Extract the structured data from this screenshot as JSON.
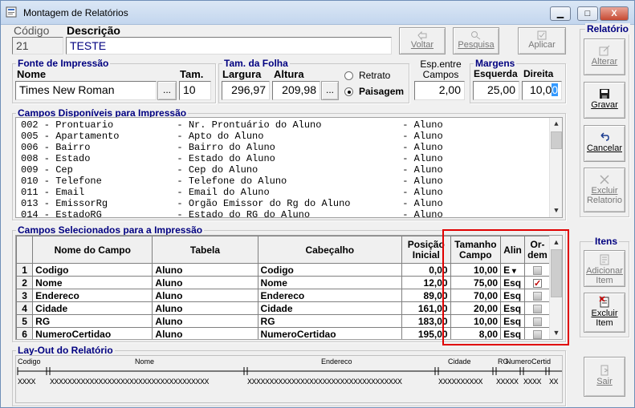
{
  "window": {
    "title": "Montagem de Relatórios",
    "controls": {
      "minimize": "▁",
      "maximize": "□",
      "close": "X"
    }
  },
  "header": {
    "codigo_label": "Código",
    "codigo_value": "21",
    "descricao_label": "Descrição",
    "descricao_value": "TESTE"
  },
  "toolbar": {
    "voltar": "Voltar",
    "pesquisa": "Pesquisa",
    "aplicar": "Aplicar"
  },
  "fonte": {
    "legend": "Fonte de Impressão",
    "nome_label": "Nome",
    "nome_value": "Times New Roman",
    "browse": "...",
    "tam_label": "Tam.",
    "tam_value": "10"
  },
  "folha": {
    "legend": "Tam. da Folha",
    "largura_label": "Largura",
    "largura_value": "296,97",
    "altura_label": "Altura",
    "altura_value": "209,98",
    "browse": "...",
    "retrato": "Retrato",
    "paisagem": "Paisagem",
    "selected": "paisagem"
  },
  "espacamento": {
    "label_line1": "Esp.entre",
    "label_line2": "Campos",
    "value": "2,00"
  },
  "margens": {
    "legend": "Margens",
    "esquerda_label": "Esquerda",
    "esquerda_value": "25,00",
    "direita_label": "Direita",
    "direita_value_main": "10,0",
    "direita_value_sel": "0"
  },
  "relatorio": {
    "legend": "Relatório",
    "alterar": "Alterar",
    "gravar": "Gravar",
    "cancelar": "Cancelar",
    "excluir_line1": "Excluir",
    "excluir_line2": "Relatorio"
  },
  "disponiveis": {
    "legend": "Campos Disponíveis para Impressão",
    "rows": [
      "002 - Prontuario           - Nr. Prontuário do Aluno              - Aluno",
      "005 - Apartamento          - Apto do Aluno                        - Aluno",
      "006 - Bairro               - Bairro do Aluno                      - Aluno",
      "008 - Estado               - Estado do Aluno                      - Aluno",
      "009 - Cep                  - Cep do Aluno                         - Aluno",
      "010 - Telefone             - Telefone do Aluno                    - Aluno",
      "011 - Email                - Email do Aluno                       - Aluno",
      "013 - EmissorRg            - Orgão Emissor do Rg do Aluno         - Aluno",
      "014 - EstadoRG             - Estado do RG do Aluno                - Aluno"
    ]
  },
  "selecionados": {
    "legend": "Campos Selecionados para a Impressão",
    "columns": [
      "Nome do Campo",
      "Tabela",
      "Cabeçalho",
      "Posição Inicial",
      "Tamanho Campo",
      "Alin",
      "Or- dem"
    ],
    "col_posicao": [
      "Posição",
      "Inicial"
    ],
    "col_tamanho": [
      "Tamanho",
      "Campo"
    ],
    "col_ordem": [
      "Or-",
      "dem"
    ],
    "rows": [
      {
        "n": "1",
        "campo": "Codigo",
        "tabela": "Aluno",
        "cabecalho": "Codigo",
        "posicao": "0,00",
        "tamanho": "10,00",
        "alin": "E",
        "ordem": false
      },
      {
        "n": "2",
        "campo": "Nome",
        "tabela": "Aluno",
        "cabecalho": "Nome",
        "posicao": "12,00",
        "tamanho": "75,00",
        "alin": "Esq",
        "ordem": true
      },
      {
        "n": "3",
        "campo": "Endereco",
        "tabela": "Aluno",
        "cabecalho": "Endereco",
        "posicao": "89,00",
        "tamanho": "70,00",
        "alin": "Esq",
        "ordem": false
      },
      {
        "n": "4",
        "campo": "Cidade",
        "tabela": "Aluno",
        "cabecalho": "Cidade",
        "posicao": "161,00",
        "tamanho": "20,00",
        "alin": "Esq",
        "ordem": false
      },
      {
        "n": "5",
        "campo": "RG",
        "tabela": "Aluno",
        "cabecalho": "RG",
        "posicao": "183,00",
        "tamanho": "10,00",
        "alin": "Esq",
        "ordem": false
      },
      {
        "n": "6",
        "campo": "NumeroCertidao",
        "tabela": "Aluno",
        "cabecalho": "NumeroCertidao",
        "posicao": "195,00",
        "tamanho": "8,00",
        "alin": "Esq",
        "ordem": false
      }
    ],
    "highlight_color": "#e00000"
  },
  "itens": {
    "legend": "Itens",
    "adicionar_line1": "Adicionar",
    "adicionar_line2": "Item",
    "excluir_line1": "Excluir",
    "excluir_line2": "Item"
  },
  "layout": {
    "legend": "Lay-Out do Relatório",
    "headers": [
      "Codigo",
      "Nome",
      "Endereco",
      "Cidade",
      "RG",
      "NumeroCertidao"
    ],
    "header_numero": "NumeroCertid",
    "xs": [
      "XXXX",
      "XXXXXXXXXXXXXXXXXXXXXXXXXXXXXXXXXXXX",
      "XXXXXXXXXXXXXXXXXXXXXXXXXXXXXXXXXXX",
      "XXXXXXXXXX",
      "XXXXX",
      "XXXX",
      "XX",
      "XX"
    ]
  },
  "sair": "Sair"
}
